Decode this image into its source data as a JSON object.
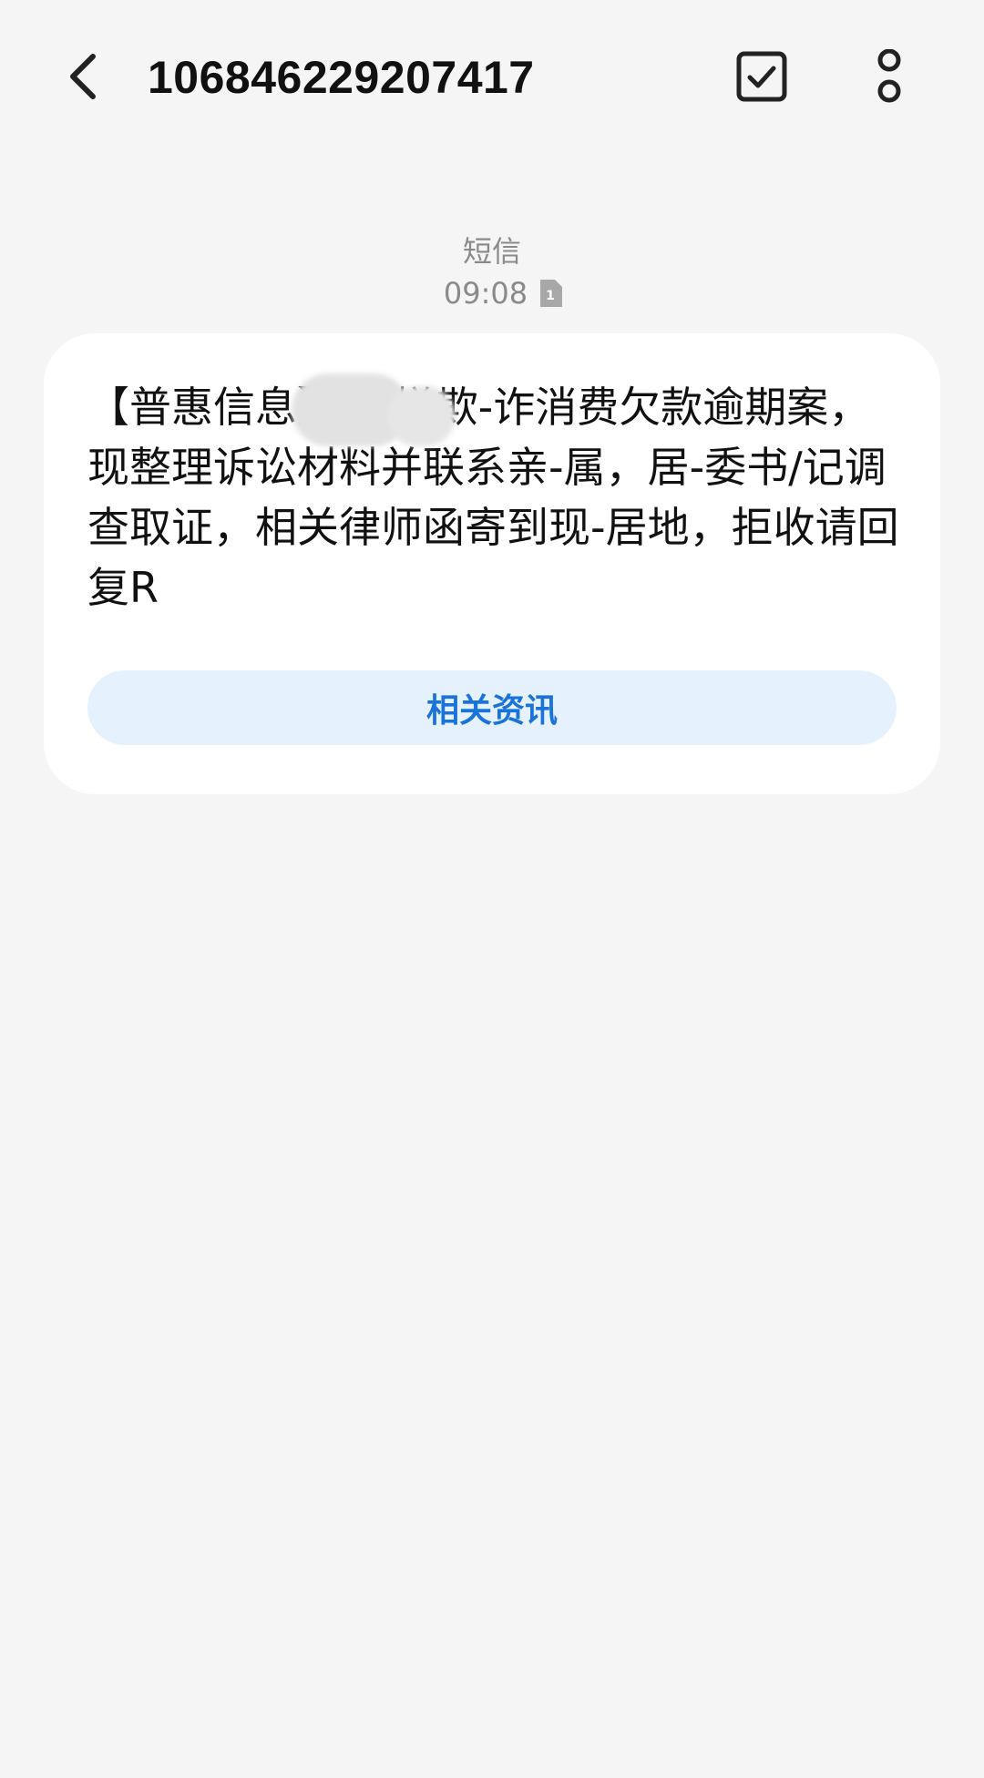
{
  "header": {
    "title": "106846229207417",
    "back_icon": "chevron-left-icon",
    "select_icon": "checkbox-icon",
    "more_icon": "more-vertical-icon"
  },
  "meta": {
    "type": "短信",
    "time": "09:08",
    "sim_badge": "1"
  },
  "message": {
    "text": "【普惠信息】        涉嫌欺-诈消费欠款逾期案，现整理诉讼材料并联系亲-属，居-委书/记调查取证，相关律师函寄到现-居地，拒收请回复R",
    "action_label": "相关资讯"
  },
  "colors": {
    "background": "#f5f5f5",
    "bubble": "#ffffff",
    "accent": "#1a73d9",
    "action_bg": "#e5f1fd",
    "meta_text": "#8a8a8a"
  }
}
